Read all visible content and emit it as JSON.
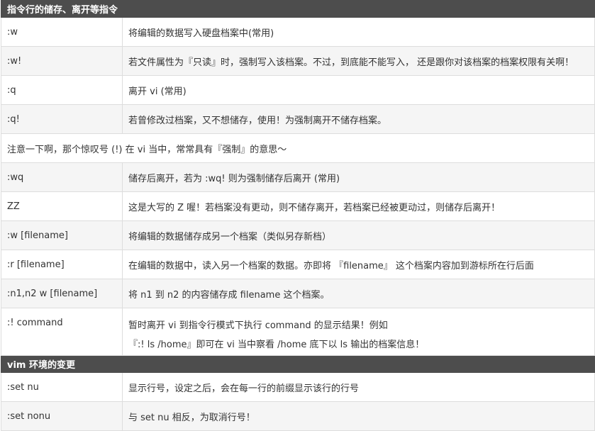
{
  "sections": [
    {
      "header": "指令行的储存、离开等指令",
      "rows": [
        {
          "cmd": ":w",
          "desc": "将编辑的数据写入硬盘档案中(常用)",
          "shaded": false
        },
        {
          "cmd": ":w!",
          "desc": "若文件属性为『只读』时，强制写入该档案。不过，到底能不能写入， 还是跟你对该档案的档案权限有关啊！",
          "shaded": true
        },
        {
          "cmd": ":q",
          "desc": "离开 vi (常用)",
          "shaded": false
        },
        {
          "cmd": ":q!",
          "desc": "若曾修改过档案，又不想储存，使用！为强制离开不储存档案。",
          "shaded": true
        }
      ],
      "note": "注意一下啊，那个惊叹号 (!) 在 vi 当中，常常具有『强制』的意思～",
      "rows2": [
        {
          "cmd": ":wq",
          "desc": "储存后离开，若为 :wq! 则为强制储存后离开 (常用)",
          "shaded": true
        },
        {
          "cmd": "ZZ",
          "desc": "这是大写的 Z 喔！若档案没有更动，则不储存离开，若档案已经被更动过，则储存后离开！",
          "shaded": false
        },
        {
          "cmd": ":w [filename]",
          "desc": "将编辑的数据储存成另一个档案（类似另存新档）",
          "shaded": true
        },
        {
          "cmd": ":r [filename]",
          "desc": "在编辑的数据中，读入另一个档案的数据。亦即将 『filename』 这个档案内容加到游标所在行后面",
          "shaded": false
        },
        {
          "cmd": ":n1,n2 w [filename]",
          "desc": "将 n1 到 n2 的内容储存成 filename 这个档案。",
          "shaded": true
        }
      ],
      "tall_row": {
        "cmd": ":! command",
        "desc_line1": "暂时离开 vi 到指令行模式下执行 command 的显示结果！例如",
        "desc_line2": "『:! ls /home』即可在 vi 当中察看 /home 底下以 ls 输出的档案信息！"
      }
    },
    {
      "header": "vim 环境的变更",
      "rows": [
        {
          "cmd": ":set nu",
          "desc": "显示行号，设定之后，会在每一行的前缀显示该行的行号",
          "shaded": false
        },
        {
          "cmd": ":set nonu",
          "desc": "与 set nu 相反，为取消行号！",
          "shaded": true
        }
      ]
    }
  ],
  "colors": {
    "header_bg": "#4d4d4d",
    "header_text": "#ffffff",
    "shaded_row": "#f5f5f5",
    "border": "#dddddd",
    "text": "#333333"
  }
}
